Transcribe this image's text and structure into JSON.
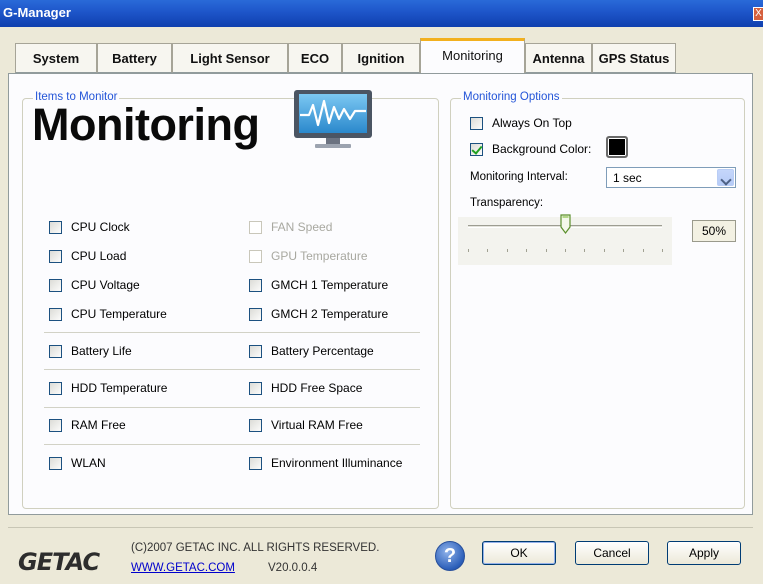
{
  "window": {
    "title": "G-Manager",
    "close_label": "X"
  },
  "tabs": [
    {
      "label": "System"
    },
    {
      "label": "Battery"
    },
    {
      "label": "Light Sensor"
    },
    {
      "label": "ECO"
    },
    {
      "label": "Ignition"
    },
    {
      "label": "Monitoring",
      "active": true
    },
    {
      "label": "Antenna"
    },
    {
      "label": "GPS Status"
    }
  ],
  "items_group": {
    "legend": "Items to Monitor",
    "big_title": "Monitoring",
    "icon": "monitor-chart-icon",
    "checkboxes": [
      {
        "label": "CPU Clock",
        "checked": false,
        "enabled": true
      },
      {
        "label": "FAN Speed",
        "checked": false,
        "enabled": false
      },
      {
        "label": "CPU Load",
        "checked": false,
        "enabled": true
      },
      {
        "label": "GPU Temperature",
        "checked": false,
        "enabled": false
      },
      {
        "label": "CPU Voltage",
        "checked": false,
        "enabled": true
      },
      {
        "label": "GMCH 1 Temperature",
        "checked": false,
        "enabled": true
      },
      {
        "label": "CPU Temperature",
        "checked": false,
        "enabled": true
      },
      {
        "label": "GMCH 2 Temperature",
        "checked": false,
        "enabled": true
      },
      {
        "label": "Battery Life",
        "checked": false,
        "enabled": true
      },
      {
        "label": "Battery Percentage",
        "checked": false,
        "enabled": true
      },
      {
        "label": "HDD Temperature",
        "checked": false,
        "enabled": true
      },
      {
        "label": "HDD Free Space",
        "checked": false,
        "enabled": true
      },
      {
        "label": "RAM Free",
        "checked": false,
        "enabled": true
      },
      {
        "label": "Virtual RAM Free",
        "checked": false,
        "enabled": true
      },
      {
        "label": "WLAN",
        "checked": false,
        "enabled": true
      },
      {
        "label": "Environment Illuminance",
        "checked": false,
        "enabled": true
      }
    ]
  },
  "options_group": {
    "legend": "Monitoring Options",
    "always_on_top": {
      "label": "Always On Top",
      "checked": false
    },
    "background_color": {
      "label": "Background Color:",
      "checked": true,
      "color": "#000000"
    },
    "interval": {
      "label": "Monitoring Interval:",
      "value": "1 sec"
    },
    "transparency": {
      "label": "Transparency:",
      "value_text": "50%",
      "fraction": 0.5
    }
  },
  "footer": {
    "logo": "GETAC",
    "copyright": "(C)2007 GETAC INC. ALL RIGHTS RESERVED.",
    "link": "WWW.GETAC.COM",
    "version": "V20.0.0.4",
    "help_glyph": "?",
    "ok_label": "OK",
    "cancel_label": "Cancel",
    "apply_label": "Apply"
  },
  "colors": {
    "title_bar": "#1d55c9",
    "tab_accent": "#f2b01e",
    "legend_text": "#2455d8",
    "link": "#0000cc"
  }
}
